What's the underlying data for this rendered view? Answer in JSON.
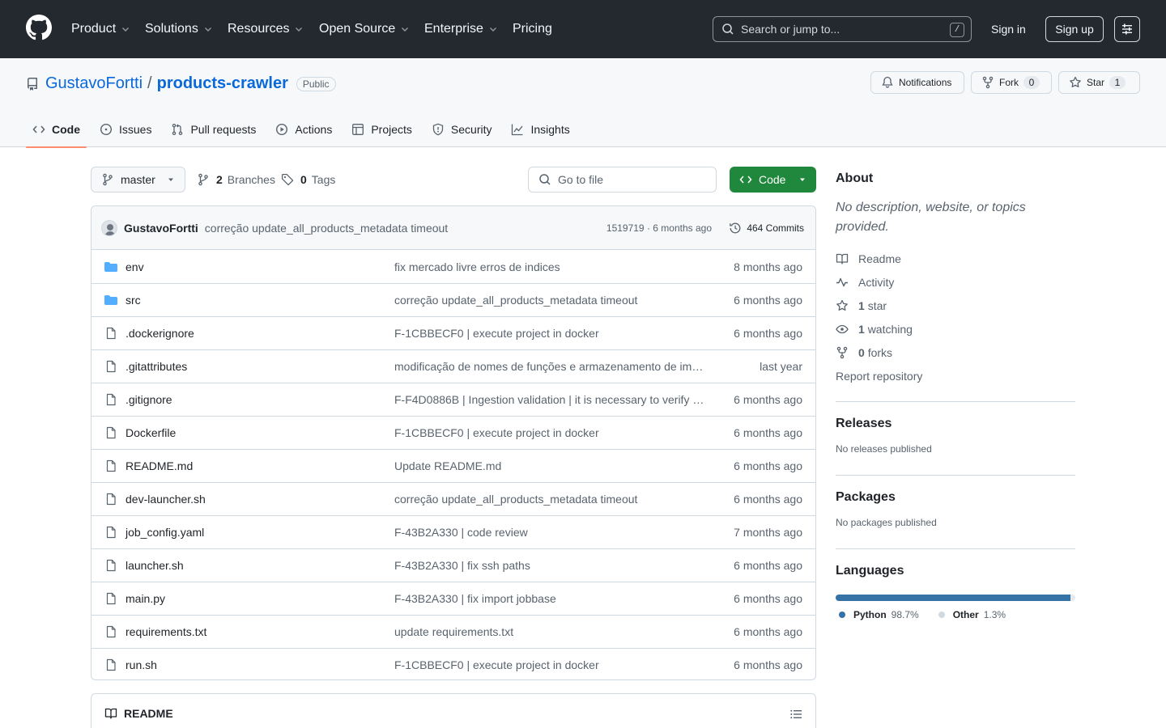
{
  "header": {
    "nav": [
      "Product",
      "Solutions",
      "Resources",
      "Open Source",
      "Enterprise",
      "Pricing"
    ],
    "search_placeholder": "Search or jump to...",
    "search_shortcut": "/",
    "sign_in": "Sign in",
    "sign_up": "Sign up"
  },
  "repo": {
    "owner": "GustavoFortti",
    "separator": "/",
    "name": "products-crawler",
    "visibility": "Public",
    "notifications_label": "Notifications",
    "fork_label": "Fork",
    "fork_count": "0",
    "star_label": "Star",
    "star_count": "1"
  },
  "tabs": [
    {
      "label": "Code",
      "icon": "code-icon",
      "active": true
    },
    {
      "label": "Issues",
      "icon": "issue-icon"
    },
    {
      "label": "Pull requests",
      "icon": "pull-request-icon"
    },
    {
      "label": "Actions",
      "icon": "play-icon"
    },
    {
      "label": "Projects",
      "icon": "table-icon"
    },
    {
      "label": "Security",
      "icon": "shield-icon"
    },
    {
      "label": "Insights",
      "icon": "graph-icon"
    }
  ],
  "toolbar": {
    "branch": "master",
    "branches_count": "2",
    "branches_label": "Branches",
    "tags_count": "0",
    "tags_label": "Tags",
    "goto_placeholder": "Go to file",
    "code_label": "Code"
  },
  "latest_commit": {
    "author": "GustavoFortti",
    "message": "correção update_all_products_metadata timeout",
    "meta": "1519719 · 6 months ago",
    "commits_label": "464 Commits"
  },
  "files": [
    {
      "type": "dir",
      "name": "env",
      "message": "fix mercado livre erros de indices",
      "date": "8 months ago"
    },
    {
      "type": "dir",
      "name": "src",
      "message": "correção update_all_products_metadata timeout",
      "date": "6 months ago"
    },
    {
      "type": "file",
      "name": ".dockerignore",
      "message": "F-1CBBECF0 | execute project in docker",
      "date": "6 months ago"
    },
    {
      "type": "file",
      "name": ".gitattributes",
      "message": "modificação de nomes de funções e armazenamento de im…",
      "date": "last year"
    },
    {
      "type": "file",
      "name": ".gitignore",
      "message": "F-F4D0886B | Ingestion validation | it is necessary to verify …",
      "date": "6 months ago"
    },
    {
      "type": "file",
      "name": "Dockerfile",
      "message": "F-1CBBECF0 | execute project in docker",
      "date": "6 months ago"
    },
    {
      "type": "file",
      "name": "README.md",
      "message": "Update README.md",
      "date": "6 months ago"
    },
    {
      "type": "file",
      "name": "dev-launcher.sh",
      "message": "correção update_all_products_metadata timeout",
      "date": "6 months ago"
    },
    {
      "type": "file",
      "name": "job_config.yaml",
      "message": "F-43B2A330 | code review",
      "date": "7 months ago"
    },
    {
      "type": "file",
      "name": "launcher.sh",
      "message": "F-43B2A330 | fix ssh paths",
      "date": "6 months ago"
    },
    {
      "type": "file",
      "name": "main.py",
      "message": "F-43B2A330 | fix import jobbase",
      "date": "6 months ago"
    },
    {
      "type": "file",
      "name": "requirements.txt",
      "message": "update requirements.txt",
      "date": "6 months ago"
    },
    {
      "type": "file",
      "name": "run.sh",
      "message": "F-1CBBECF0 | execute project in docker",
      "date": "6 months ago"
    }
  ],
  "readme": {
    "title": "README"
  },
  "about": {
    "title": "About",
    "description": "No description, website, or topics provided.",
    "readme": "Readme",
    "activity": "Activity",
    "stars_count": "1",
    "stars_label": "star",
    "watching_count": "1",
    "watching_label": "watching",
    "forks_count": "0",
    "forks_label": "forks",
    "report": "Report repository"
  },
  "releases": {
    "title": "Releases",
    "text": "No releases published"
  },
  "packages": {
    "title": "Packages",
    "text": "No packages published"
  },
  "languages": {
    "title": "Languages",
    "items": [
      {
        "name": "Python",
        "percent": "98.7%",
        "value": 98.7,
        "color": "#3572A5"
      },
      {
        "name": "Other",
        "percent": "1.3%",
        "value": 1.3,
        "color": "#e6eaef"
      }
    ]
  },
  "colors": {
    "accent": "#0969da",
    "header_bg": "#24292f",
    "primary_button": "#1f883d",
    "folder": "#54aeff",
    "active_tab_underline": "#fd8c73"
  }
}
